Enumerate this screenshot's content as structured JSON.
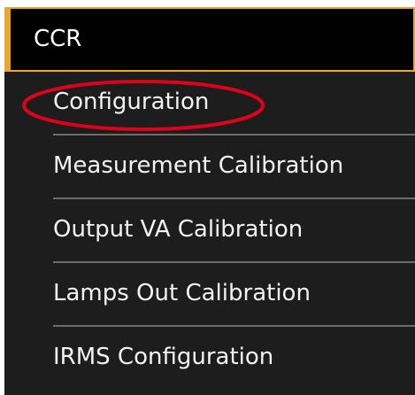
{
  "header": {
    "title": "CCR"
  },
  "menu": {
    "items": [
      {
        "label": "Configuration"
      },
      {
        "label": "Measurement Calibration"
      },
      {
        "label": "Output VA Calibration"
      },
      {
        "label": "Lamps Out Calibration"
      },
      {
        "label": "IRMS Configuration"
      }
    ]
  },
  "colors": {
    "accent": "#f0a81a",
    "header_background": "#000000",
    "menu_background": "#1d1d1d",
    "annotation": "#e0001b",
    "text": "#f2f2f2",
    "divider": "#6d6d6d"
  }
}
